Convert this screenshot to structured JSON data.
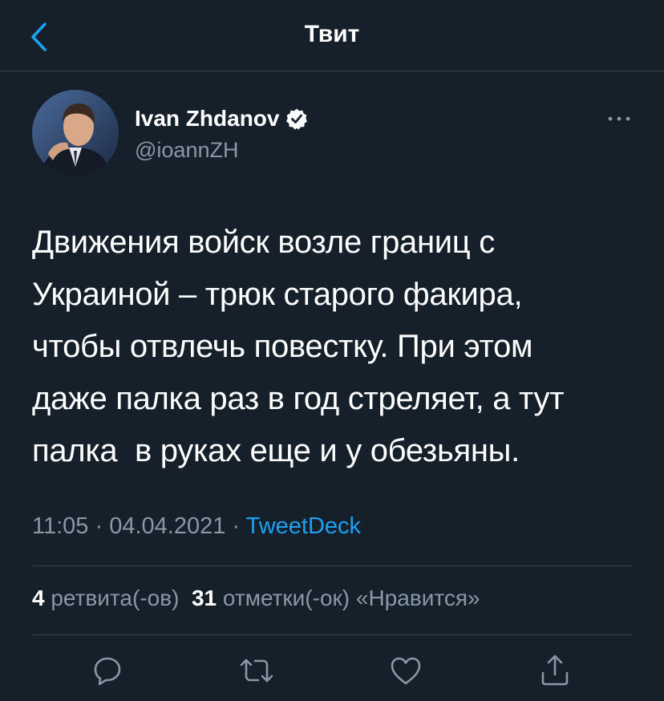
{
  "header": {
    "title": "Твит"
  },
  "author": {
    "name": "Ivan Zhdanov",
    "handle": "@ioannZH",
    "verified": true
  },
  "tweet": {
    "text": "Движения войск возле границ с\nУкраиной – трюк старого факира,\nчтобы отвлечь повестку. При этом\nдаже палка раз в год стреляет, а тут\nпалка  в руках еще и у обезьяны.",
    "time": "11:05",
    "date": "04.04.2021",
    "separator": " · ",
    "source": "TweetDeck"
  },
  "stats": {
    "retweets_count": "4",
    "retweets_label": "ретвита(-ов)",
    "likes_count": "31",
    "likes_label": "отметки(-ок) «Нравится»"
  },
  "actions": {
    "icons": [
      "reply-icon",
      "retweet-icon",
      "like-icon",
      "share-icon"
    ]
  },
  "colors": {
    "background": "#15202b",
    "accent": "#1da1f2",
    "secondary_text": "#8899a6",
    "divider": "#38444d"
  }
}
